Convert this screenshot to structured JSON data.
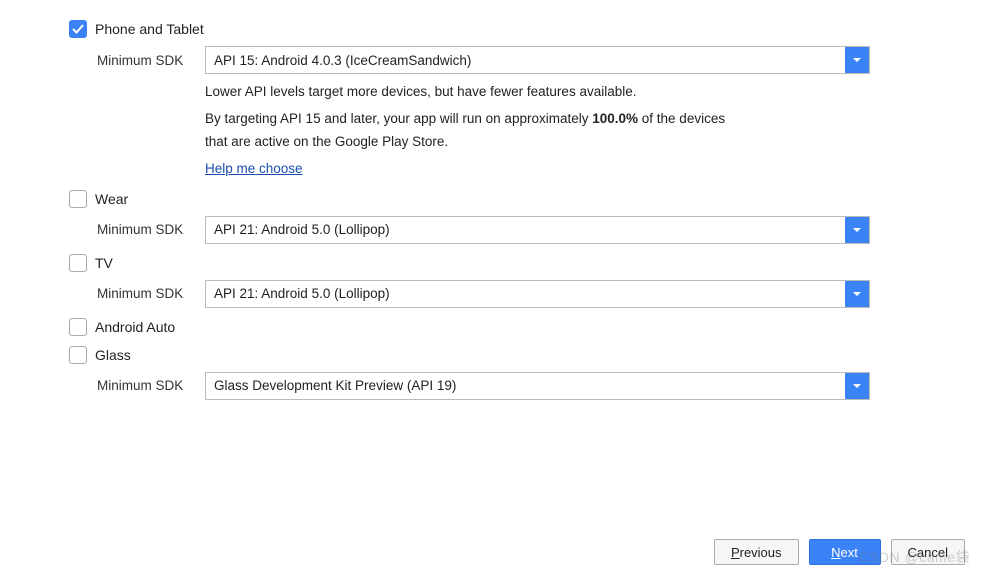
{
  "platforms": {
    "phone_tablet": {
      "label": "Phone and Tablet",
      "checked": true,
      "sdk_label": "Minimum SDK",
      "sdk_value": "API 15: Android 4.0.3 (IceCreamSandwich)",
      "hint_line1": "Lower API levels target more devices, but have fewer features available.",
      "hint_line2_pre": "By targeting API 15 and later, your app will run on approximately ",
      "hint_line2_bold": "100.0%",
      "hint_line2_post": " of the devices",
      "hint_line3": "that are active on the Google Play Store.",
      "help_link": "Help me choose"
    },
    "wear": {
      "label": "Wear",
      "checked": false,
      "sdk_label": "Minimum SDK",
      "sdk_value": "API 21: Android 5.0 (Lollipop)"
    },
    "tv": {
      "label": "TV",
      "checked": false,
      "sdk_label": "Minimum SDK",
      "sdk_value": "API 21: Android 5.0 (Lollipop)"
    },
    "android_auto": {
      "label": "Android Auto",
      "checked": false
    },
    "glass": {
      "label": "Glass",
      "checked": false,
      "sdk_label": "Minimum SDK",
      "sdk_value": "Glass Development Kit Preview (API 19)"
    }
  },
  "buttons": {
    "previous": "Previous",
    "next": "Next",
    "cancel": "Cancel"
  },
  "watermark": "CSDN @came袋"
}
